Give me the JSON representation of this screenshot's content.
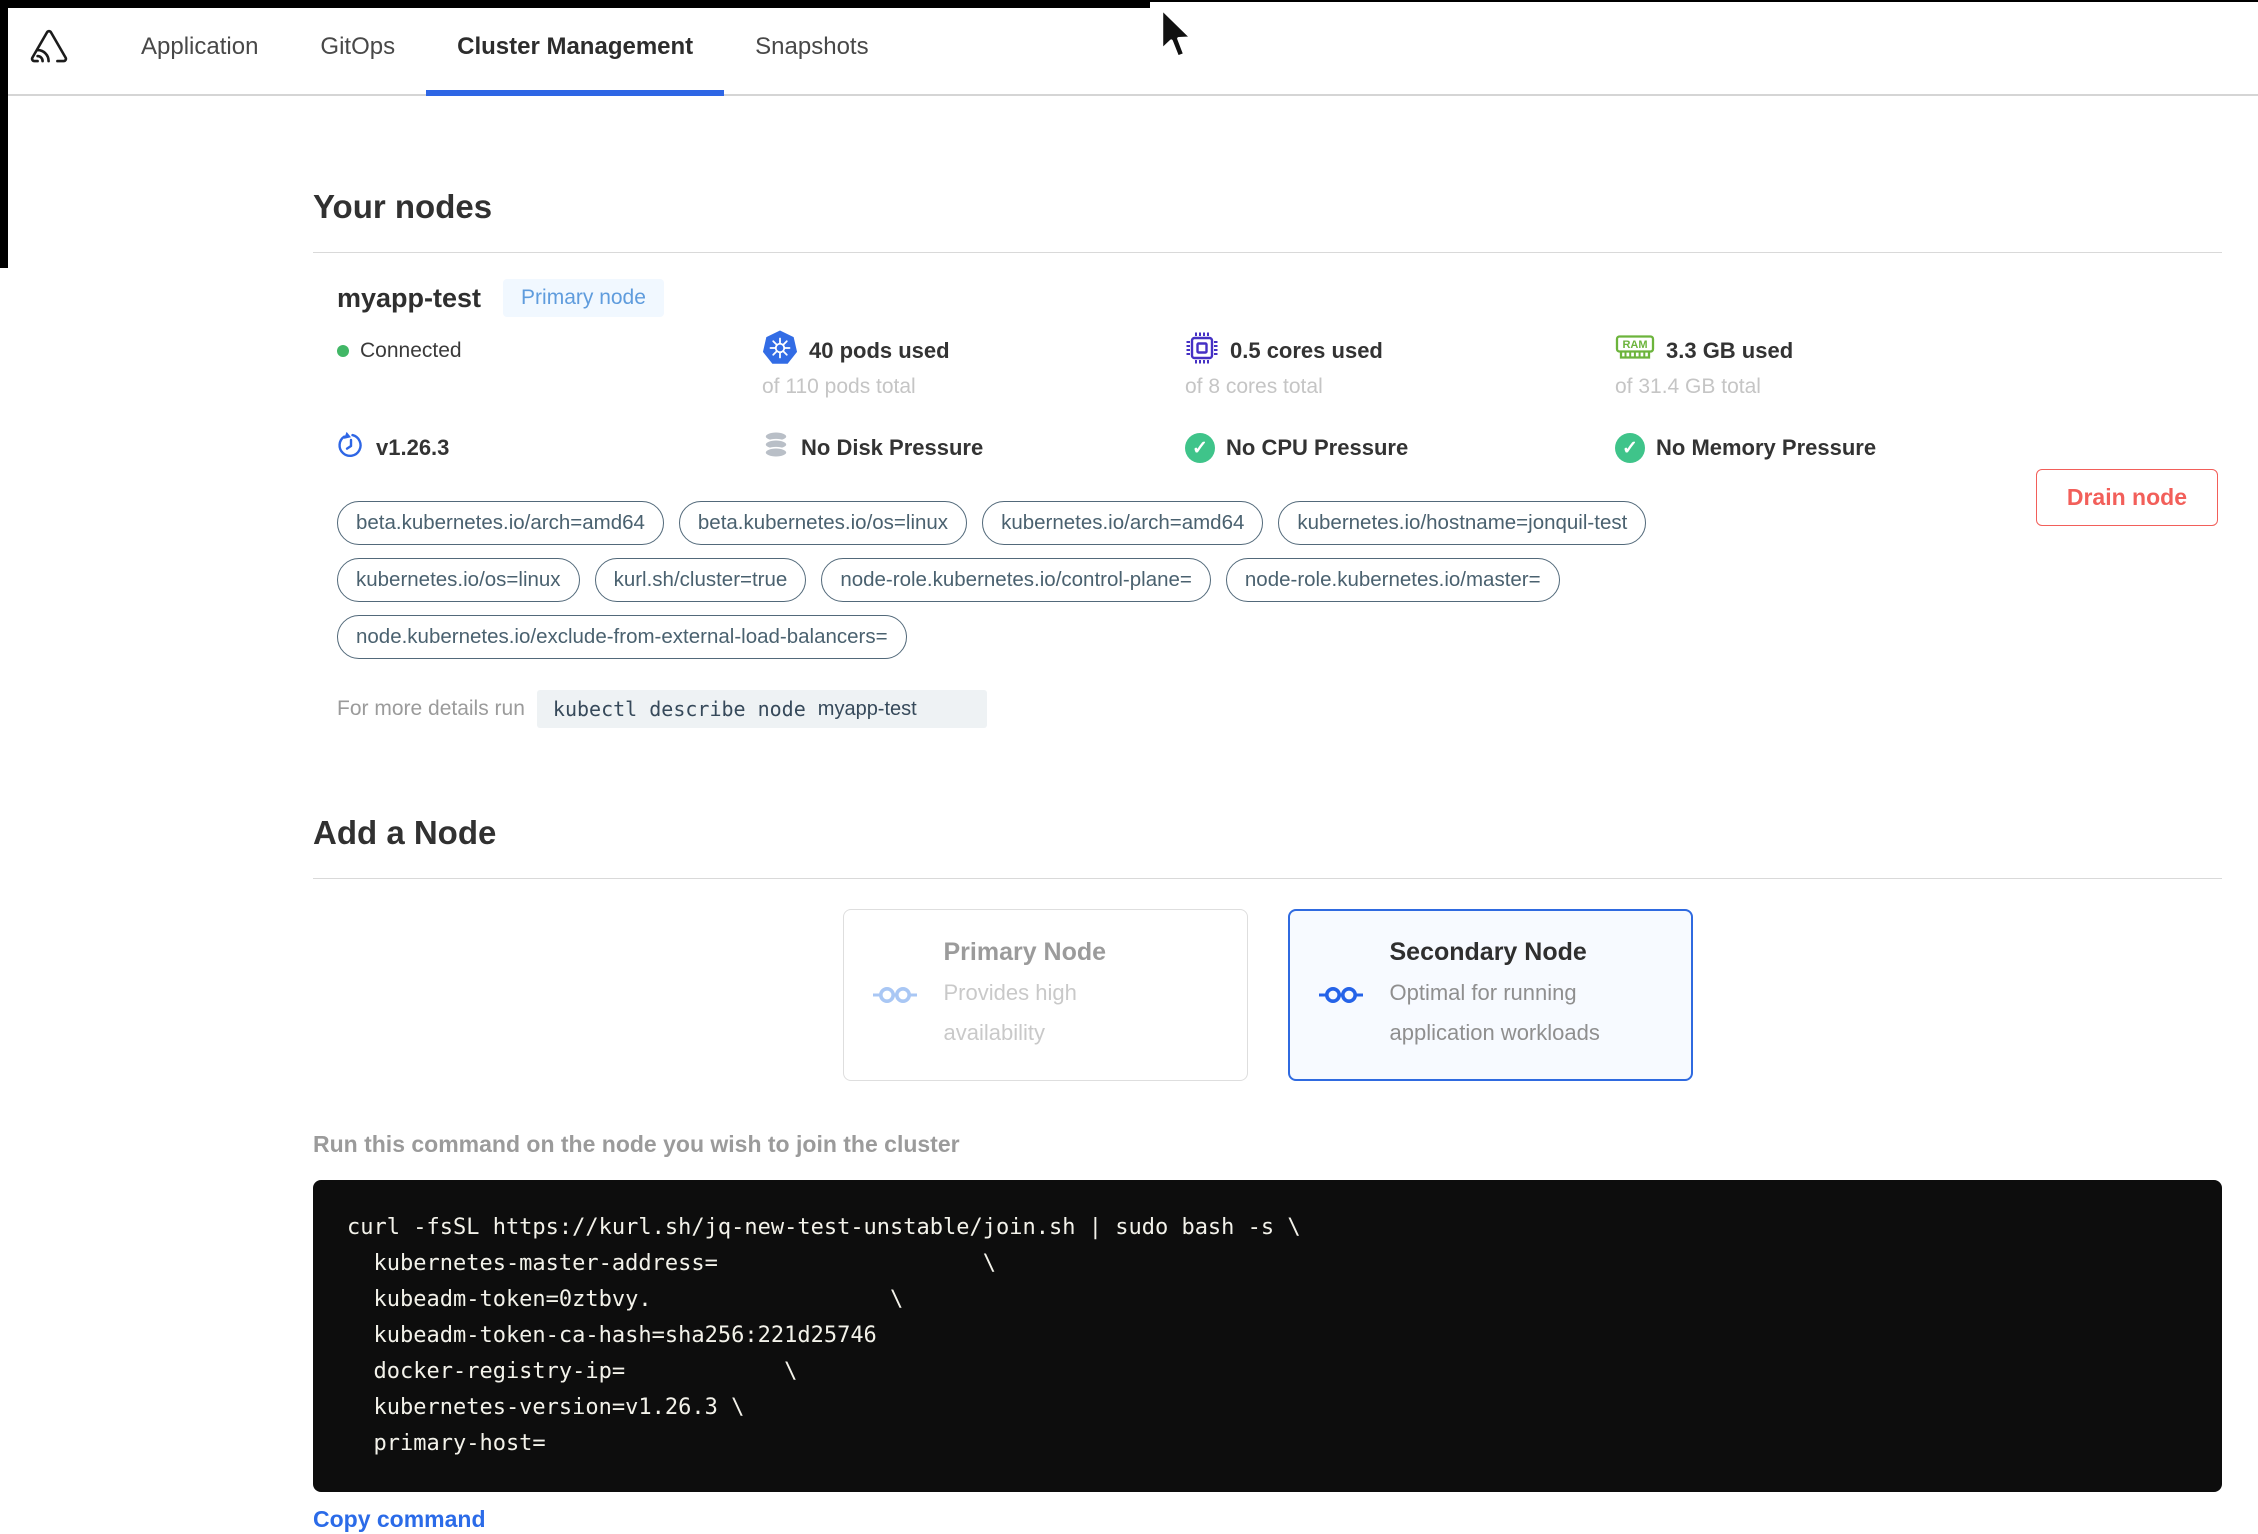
{
  "nav": {
    "logo_icon": "app-logo-icon",
    "active_tab": "Cluster Management",
    "tabs": [
      {
        "label": "Application"
      },
      {
        "label": "GitOps"
      },
      {
        "label": "Cluster Management"
      },
      {
        "label": "Snapshots"
      }
    ]
  },
  "your_nodes": {
    "title": "Your nodes",
    "node": {
      "name": "myapp-test",
      "badge": "Primary node",
      "status": "Connected",
      "version": "v1.26.3",
      "version_icon": "version-history-icon",
      "stats": [
        {
          "icon": "kubernetes-icon",
          "used": "40 pods used",
          "total": "of 110 pods total"
        },
        {
          "icon": "cpu-icon",
          "used": "0.5 cores used",
          "total": "of 8 cores total"
        },
        {
          "icon": "ram-icon",
          "used": "3.3 GB used",
          "total": "of 31.4 GB total"
        }
      ],
      "conditions": [
        {
          "icon": "disk-icon",
          "label": "No Disk Pressure"
        },
        {
          "icon": "check-circle-icon",
          "label": "No CPU Pressure"
        },
        {
          "icon": "check-circle-icon",
          "label": "No Memory Pressure"
        }
      ],
      "labels": [
        "beta.kubernetes.io/arch=amd64",
        "beta.kubernetes.io/os=linux",
        "kubernetes.io/arch=amd64",
        "kubernetes.io/hostname=jonquil-test",
        "kubernetes.io/os=linux",
        "kurl.sh/cluster=true",
        "node-role.kubernetes.io/control-plane=",
        "node-role.kubernetes.io/master=",
        "node.kubernetes.io/exclude-from-external-load-balancers="
      ],
      "details_hint": "For more details run",
      "details_command": "kubectl describe node",
      "details_command_node": "myapp-test",
      "drain_button": "Drain node"
    }
  },
  "add_node": {
    "title": "Add a Node",
    "options": [
      {
        "icon": "node-link-icon",
        "title": "Primary Node",
        "description": "Provides high availability",
        "selected": false
      },
      {
        "icon": "node-link-icon",
        "title": "Secondary Node",
        "description": "Optimal for running application workloads",
        "selected": true
      }
    ],
    "command_label": "Run this command on the node you wish to join the cluster",
    "terminal_lines": [
      "curl -fsSL https://kurl.sh/jq-new-test-unstable/join.sh | sudo bash -s \\",
      "  kubernetes-master-address=                    \\",
      "  kubeadm-token=0ztbvy.                  \\",
      "  kubeadm-token-ca-hash=sha256:221d25746",
      "  docker-registry-ip=            \\",
      "  kubernetes-version=v1.26.3 \\",
      "  primary-host="
    ],
    "copy_link": "Copy command"
  },
  "colors": {
    "accent_blue": "#2f6ae0",
    "tab_underline_blue": "#2e66e5",
    "danger_red": "#f25f5a",
    "success_green": "#3fc48a",
    "connected_green": "#41b766",
    "kubernetes_blue": "#326ce5",
    "cpu_purple": "#4531c4",
    "ram_green": "#6cb43c",
    "disk_gray": "#b9bfc7",
    "label_slate": "#4a616f",
    "badge_blue": "#5f9cdd",
    "terminal_bg": "#0d0d0d"
  }
}
